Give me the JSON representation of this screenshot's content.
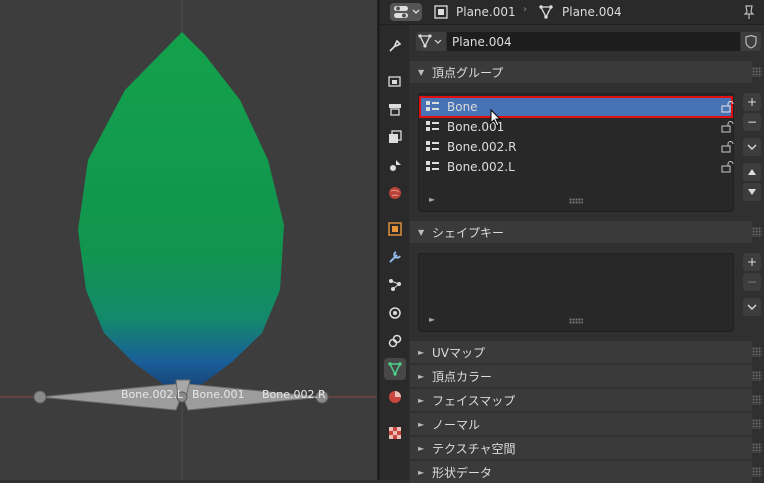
{
  "header": {
    "object_name": "Plane.001",
    "mesh_name": "Plane.004",
    "icons": [
      "object-data-icon",
      "mesh-icon",
      "pin-icon"
    ]
  },
  "mesh_selector": {
    "name": "Plane.004"
  },
  "vertex_groups": {
    "title": "頂点グループ",
    "items": [
      {
        "label": "Bone",
        "selected": true
      },
      {
        "label": "Bone.001",
        "selected": false
      },
      {
        "label": "Bone.002.R",
        "selected": false
      },
      {
        "label": "Bone.002.L",
        "selected": false
      }
    ]
  },
  "shape_keys": {
    "title": "シェイプキー"
  },
  "collapsed_panels": [
    {
      "label": "UVマップ"
    },
    {
      "label": "頂点カラー"
    },
    {
      "label": "フェイスマップ"
    },
    {
      "label": "ノーマル"
    },
    {
      "label": "テクスチャ空間"
    },
    {
      "label": "形状データ"
    }
  ],
  "viewport": {
    "bones": [
      {
        "label": "Bone.002.L"
      },
      {
        "label": "Bone.001"
      },
      {
        "label": "Bone.002.R"
      }
    ]
  },
  "colors": {
    "selection_border": "#e01010",
    "selected_row": "#4772b3",
    "leaf_green": "#14a04e",
    "leaf_blue": "#1a4f8a"
  }
}
